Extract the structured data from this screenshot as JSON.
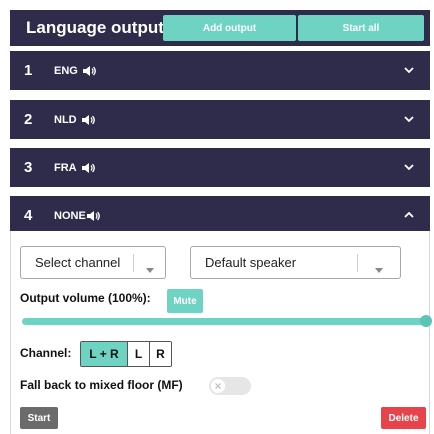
{
  "header": {
    "title": "Language outputs",
    "add_output_label": "Add output",
    "start_all_label": "Start all"
  },
  "outputs": [
    {
      "number": "1",
      "code": "ENG",
      "expanded": false,
      "icon": "speaker-icon",
      "chevron": "chevron-down-icon"
    },
    {
      "number": "2",
      "code": "NLD",
      "expanded": false,
      "icon": "speaker-icon",
      "chevron": "chevron-down-icon"
    },
    {
      "number": "3",
      "code": "FRA",
      "expanded": false,
      "icon": "speaker-icon",
      "chevron": "chevron-down-icon"
    },
    {
      "number": "4",
      "code": "NONE",
      "expanded": true,
      "icon": "speaker-icon",
      "chevron": "chevron-up-icon"
    }
  ],
  "panel": {
    "channel_select": {
      "value": "Select channel",
      "icon": "caret-down-icon"
    },
    "speaker_select": {
      "value": "Default speaker",
      "icon": "caret-down-icon"
    },
    "volume_label": "Output volume (100%):",
    "volume_percent": 100,
    "mute_label": "Mute",
    "channel_label": "Channel:",
    "channel_options": [
      "L + R",
      "L",
      "R"
    ],
    "channel_selected": "L + R",
    "fallback_label": "Fall back to mixed floor (MF)",
    "fallback_enabled": false,
    "start_label": "Start",
    "delete_label": "Delete"
  },
  "colors": {
    "header_bg": "#2f2b4a",
    "accent": "#6fd3c4",
    "delete": "#e8434a",
    "start": "#6b6b6b"
  }
}
